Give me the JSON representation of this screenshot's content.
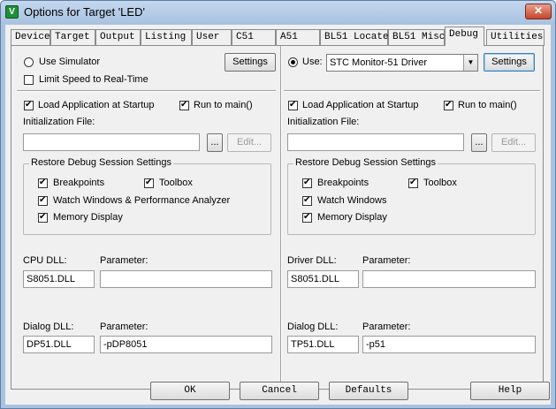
{
  "window": {
    "title": "Options for Target 'LED'",
    "icon": "uvision-app-icon",
    "close_label": "✕"
  },
  "tabs": [
    {
      "label": "Device"
    },
    {
      "label": "Target"
    },
    {
      "label": "Output"
    },
    {
      "label": "Listing"
    },
    {
      "label": "User"
    },
    {
      "label": "C51"
    },
    {
      "label": "A51"
    },
    {
      "label": "BL51 Locate"
    },
    {
      "label": "BL51 Misc"
    },
    {
      "label": "Debug",
      "active": true
    },
    {
      "label": "Utilities"
    }
  ],
  "left": {
    "use_simulator": "Use Simulator",
    "limit_speed": "Limit Speed to Real-Time",
    "settings": "Settings",
    "load_app": "Load Application at Startup",
    "run_to_main": "Run to main()",
    "init_file_label": "Initialization File:",
    "init_file_value": "",
    "browse": "...",
    "edit": "Edit...",
    "restore_group": "Restore Debug Session Settings",
    "breakpoints": "Breakpoints",
    "toolbox": "Toolbox",
    "watch_windows": "Watch Windows & Performance Analyzer",
    "memory_display": "Memory Display",
    "cpu_dll_label": "CPU DLL:",
    "cpu_dll_value": "S8051.DLL",
    "cpu_param_label": "Parameter:",
    "cpu_param_value": "",
    "dialog_dll_label": "Dialog DLL:",
    "dialog_dll_value": "DP51.DLL",
    "dialog_param_label": "Parameter:",
    "dialog_param_value": "-pDP8051"
  },
  "right": {
    "use_label": "Use:",
    "driver_value": "STC Monitor-51 Driver",
    "settings": "Settings",
    "load_app": "Load Application at Startup",
    "run_to_main": "Run to main()",
    "init_file_label": "Initialization File:",
    "init_file_value": "",
    "browse": "...",
    "edit": "Edit...",
    "restore_group": "Restore Debug Session Settings",
    "breakpoints": "Breakpoints",
    "toolbox": "Toolbox",
    "watch_windows": "Watch Windows",
    "memory_display": "Memory Display",
    "driver_dll_label": "Driver DLL:",
    "driver_dll_value": "S8051.DLL",
    "driver_param_label": "Parameter:",
    "driver_param_value": "",
    "dialog_dll_label": "Dialog DLL:",
    "dialog_dll_value": "TP51.DLL",
    "dialog_param_label": "Parameter:",
    "dialog_param_value": "-p51"
  },
  "footer": {
    "ok": "OK",
    "cancel": "Cancel",
    "defaults": "Defaults",
    "help": "Help"
  }
}
